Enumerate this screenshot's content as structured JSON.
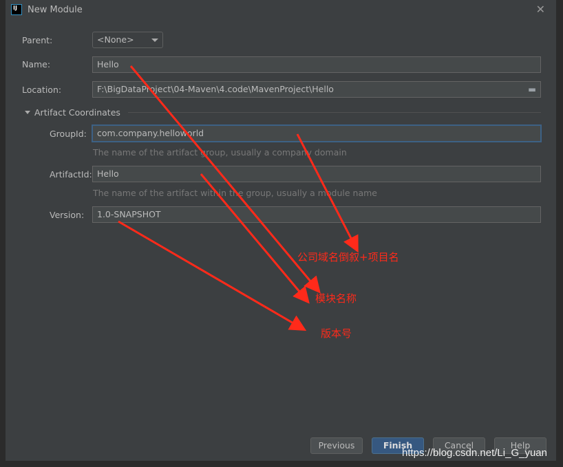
{
  "window": {
    "title": "New Module",
    "logo": "IJ"
  },
  "form": {
    "parent_label": "Parent:",
    "parent_value": "<None>",
    "name_label": "Name:",
    "name_value": "Hello",
    "location_label": "Location:",
    "location_value": "F:\\BigDataProject\\04-Maven\\4.code\\MavenProject\\Hello",
    "section_title": "Artifact Coordinates",
    "groupid_label": "GroupId:",
    "groupid_value": "com.company.helloworld",
    "groupid_hint": "The name of the artifact group, usually a company domain",
    "artifactid_label": "ArtifactId:",
    "artifactid_value": "Hello",
    "artifactid_hint": "The name of the artifact within the group, usually a module name",
    "version_label": "Version:",
    "version_value": "1.0-SNAPSHOT"
  },
  "buttons": {
    "previous": "Previous",
    "finish": "Finish",
    "cancel": "Cancel",
    "help": "Help"
  },
  "annotations": {
    "groupid_note": "公司域名倒叙+项目名",
    "artifactid_note": "模块名称",
    "version_note": "版本号",
    "color": "#ff2a1a"
  },
  "watermark": "https://blog.csdn.net/Li_G_yuan"
}
